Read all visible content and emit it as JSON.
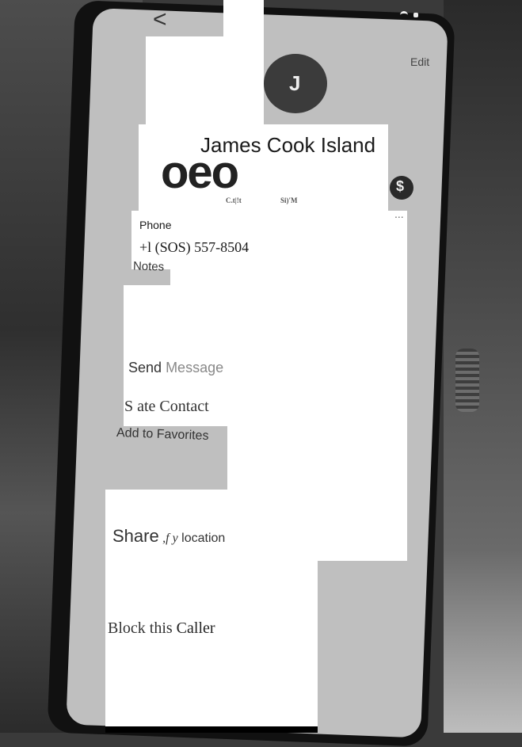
{
  "header": {
    "back_glyph": "<",
    "edit_label": "Edit"
  },
  "contact": {
    "avatar_initial": "J",
    "name": "James Cook Island",
    "action_glyphs": "oeo",
    "action_labels": [
      "C.t|!t",
      "Si)'M"
    ],
    "pay_glyph": "$",
    "more_glyph": "..."
  },
  "phone": {
    "label": "Phone",
    "number": "+l (SOS) 557-8504"
  },
  "notes": {
    "label": "Notes"
  },
  "actions": {
    "send_message_a": "Send",
    "send_message_b": "Message",
    "share_contact": "S ate Contact",
    "add_favorites": "Add to Favorites",
    "share_location_a": "Share",
    "share_location_b": ",f y",
    "share_location_c": "location",
    "block_a": "Block this",
    "block_b": "Caller"
  },
  "colors": {
    "avatar": "#3b3b3b",
    "screen": "#bfbfbf",
    "text": "#1a1a1a"
  }
}
